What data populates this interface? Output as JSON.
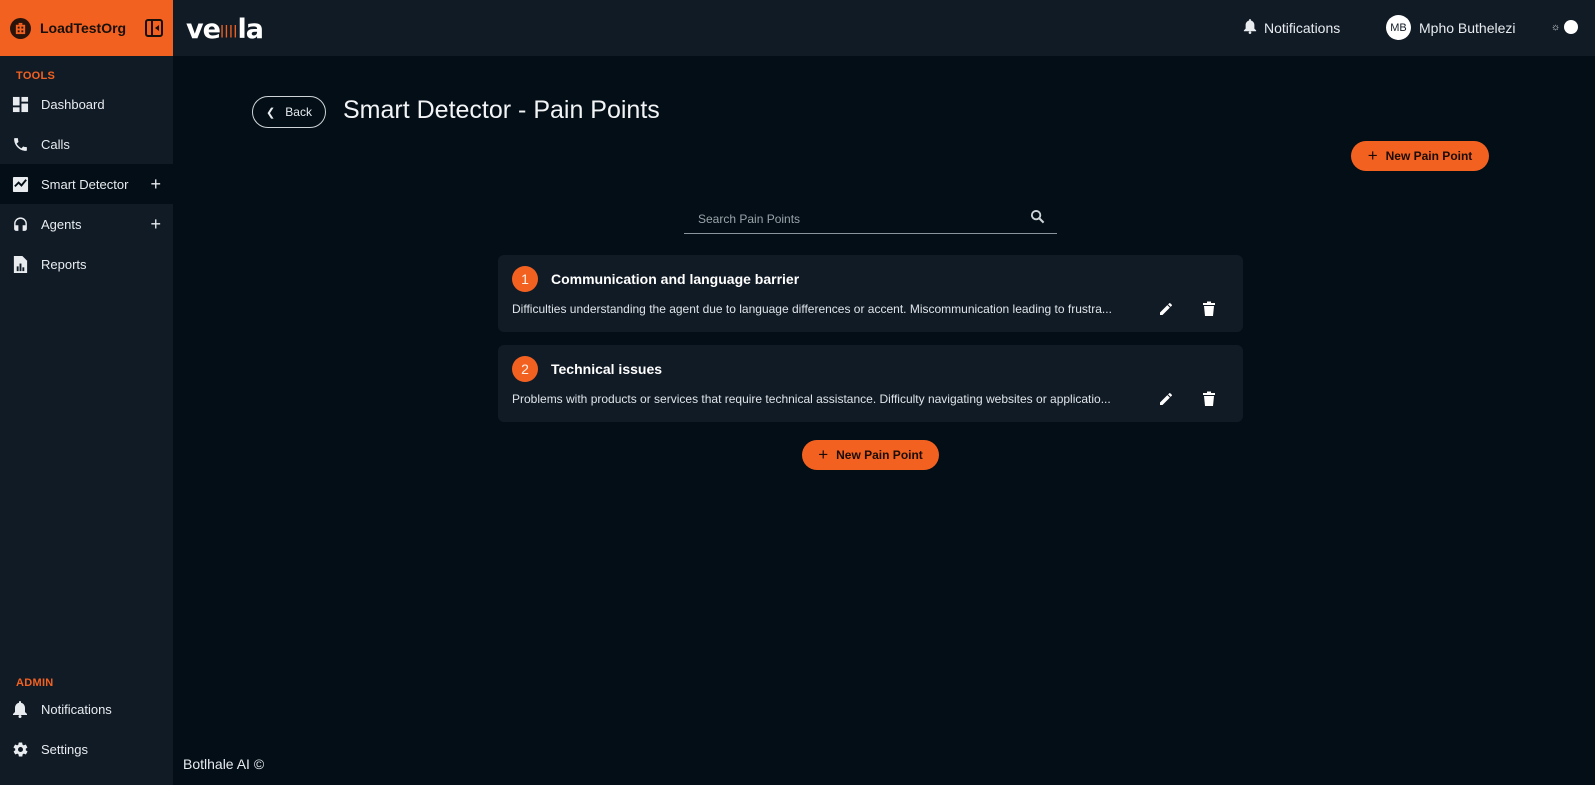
{
  "sidebar": {
    "org_name": "LoadTestOrg",
    "tools_label": "TOOLS",
    "items": [
      {
        "label": "Dashboard",
        "icon": "dashboard-icon"
      },
      {
        "label": "Calls",
        "icon": "phone-icon"
      },
      {
        "label": "Smart Detector",
        "icon": "checkbox-chart-icon",
        "active": true,
        "expandable": true
      },
      {
        "label": "Agents",
        "icon": "headset-icon",
        "expandable": true
      },
      {
        "label": "Reports",
        "icon": "report-icon"
      }
    ],
    "admin_label": "ADMIN",
    "admin_items": [
      {
        "label": "Notifications",
        "icon": "bell-icon"
      },
      {
        "label": "Settings",
        "icon": "gear-icon"
      }
    ]
  },
  "topbar": {
    "logo_text_left": "ve",
    "logo_text_right": "la",
    "notifications_label": "Notifications",
    "user_initials": "MB",
    "user_name": "Mpho Buthelezi"
  },
  "page": {
    "back_label": "Back",
    "title": "Smart Detector - Pain Points",
    "new_button_label": "New Pain Point",
    "search_placeholder": "Search Pain Points",
    "pain_points": [
      {
        "number": "1",
        "title": "Communication and language barrier",
        "description": "Difficulties understanding the agent due to language differences or accent. Miscommunication leading to frustra..."
      },
      {
        "number": "2",
        "title": "Technical issues",
        "description": "Problems with products or services that require technical assistance. Difficulty navigating websites or applicatio..."
      }
    ]
  },
  "footer": {
    "text": "Botlhale AI ©"
  },
  "colors": {
    "accent": "#f36121",
    "background": "#030e16",
    "panel": "#111b26"
  }
}
